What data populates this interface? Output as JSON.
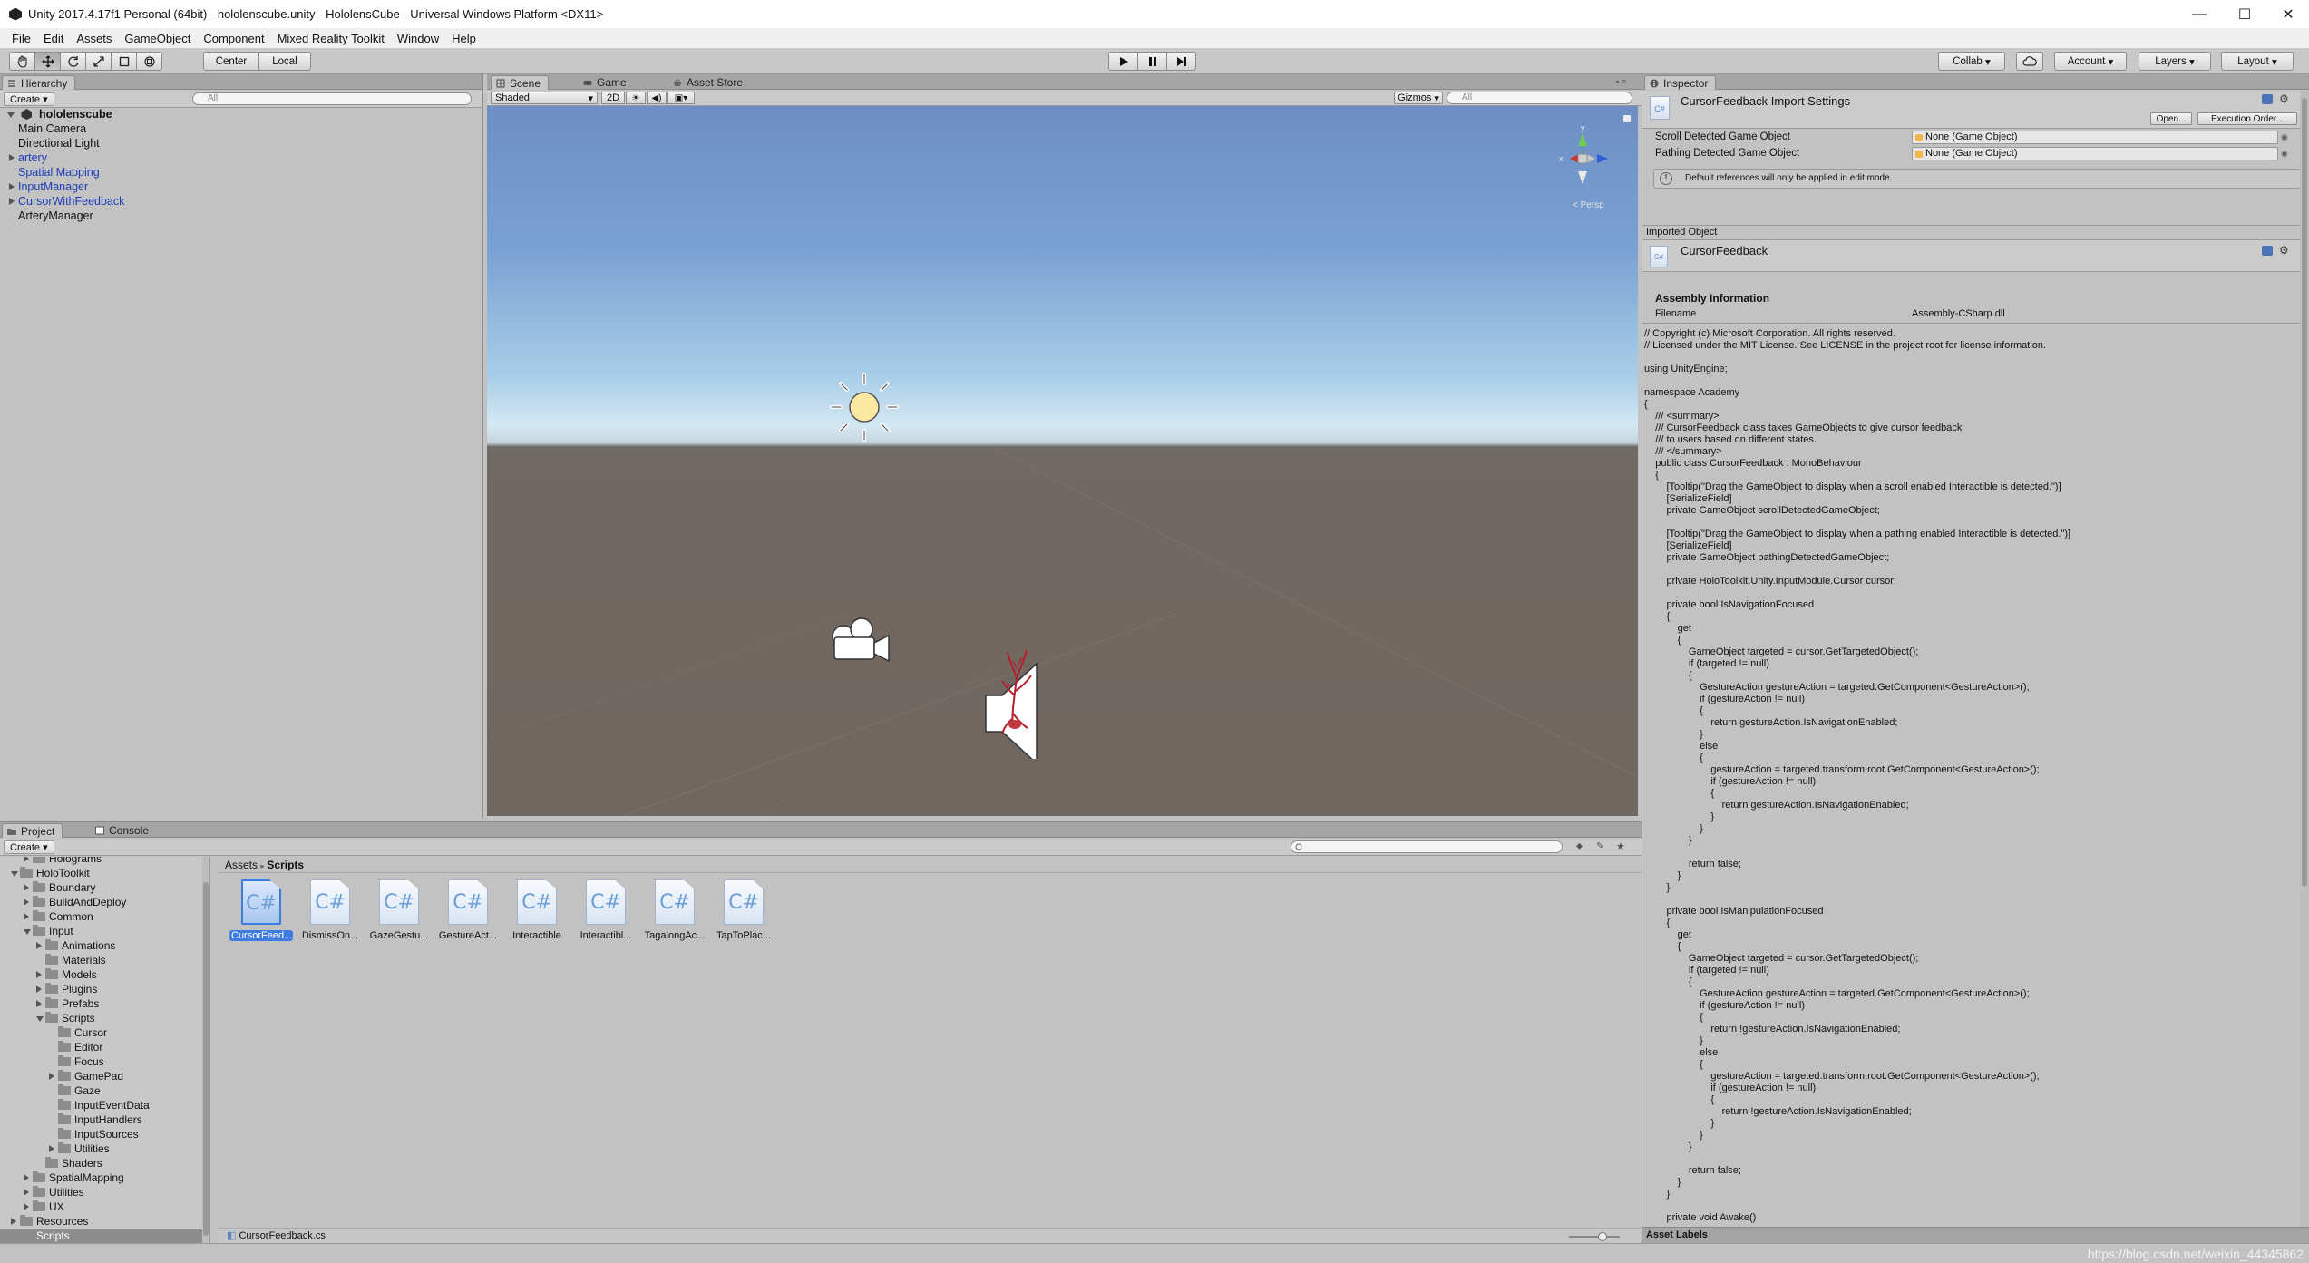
{
  "window": {
    "title": "Unity 2017.4.17f1 Personal (64bit) - hololenscube.unity - HololensCube - Universal Windows Platform <DX11>",
    "minimize": "—",
    "maximize": "☐",
    "close": "✕"
  },
  "menu": [
    "File",
    "Edit",
    "Assets",
    "GameObject",
    "Component",
    "Mixed Reality Toolkit",
    "Window",
    "Help"
  ],
  "toolbar": {
    "pivot": "Center",
    "space": "Local",
    "collab": "Collab",
    "account": "Account",
    "layers": "Layers",
    "layout": "Layout"
  },
  "hierarchy": {
    "tab": "Hierarchy",
    "create": "Create",
    "search_placeholder": "All",
    "scene": "hololenscube",
    "items": [
      {
        "label": "Main Camera",
        "blue": false,
        "expandable": false
      },
      {
        "label": "Directional Light",
        "blue": false,
        "expandable": false
      },
      {
        "label": "artery",
        "blue": true,
        "expandable": true
      },
      {
        "label": "Spatial Mapping",
        "blue": true,
        "expandable": false
      },
      {
        "label": "InputManager",
        "blue": true,
        "expandable": true
      },
      {
        "label": "CursorWithFeedback",
        "blue": true,
        "expandable": true
      },
      {
        "label": "ArteryManager",
        "blue": false,
        "expandable": false
      }
    ]
  },
  "scene": {
    "tabs": [
      "Scene",
      "Game",
      "Asset Store"
    ],
    "shading": "Shaded",
    "mode2d": "2D",
    "gizmos": "Gizmos",
    "search_placeholder": "All",
    "persp": "Persp",
    "axes": {
      "x": "x",
      "y": "y"
    }
  },
  "project": {
    "tabs": [
      "Project",
      "Console"
    ],
    "create": "Create",
    "breadcrumb": [
      "Assets",
      "Scripts"
    ],
    "tree": [
      {
        "label": "Holograms",
        "indent": 2,
        "arrow": "right"
      },
      {
        "label": "HoloToolkit",
        "indent": 1,
        "arrow": "down"
      },
      {
        "label": "Boundary",
        "indent": 2,
        "arrow": "right"
      },
      {
        "label": "BuildAndDeploy",
        "indent": 2,
        "arrow": "right"
      },
      {
        "label": "Common",
        "indent": 2,
        "arrow": "right"
      },
      {
        "label": "Input",
        "indent": 2,
        "arrow": "down"
      },
      {
        "label": "Animations",
        "indent": 3,
        "arrow": "right"
      },
      {
        "label": "Materials",
        "indent": 3,
        "arrow": ""
      },
      {
        "label": "Models",
        "indent": 3,
        "arrow": "right"
      },
      {
        "label": "Plugins",
        "indent": 3,
        "arrow": "right"
      },
      {
        "label": "Prefabs",
        "indent": 3,
        "arrow": "right"
      },
      {
        "label": "Scripts",
        "indent": 3,
        "arrow": "down"
      },
      {
        "label": "Cursor",
        "indent": 4,
        "arrow": ""
      },
      {
        "label": "Editor",
        "indent": 4,
        "arrow": ""
      },
      {
        "label": "Focus",
        "indent": 4,
        "arrow": ""
      },
      {
        "label": "GamePad",
        "indent": 4,
        "arrow": "right"
      },
      {
        "label": "Gaze",
        "indent": 4,
        "arrow": ""
      },
      {
        "label": "InputEventData",
        "indent": 4,
        "arrow": ""
      },
      {
        "label": "InputHandlers",
        "indent": 4,
        "arrow": ""
      },
      {
        "label": "InputSources",
        "indent": 4,
        "arrow": ""
      },
      {
        "label": "Utilities",
        "indent": 4,
        "arrow": "right"
      },
      {
        "label": "Shaders",
        "indent": 3,
        "arrow": ""
      },
      {
        "label": "SpatialMapping",
        "indent": 2,
        "arrow": "right"
      },
      {
        "label": "Utilities",
        "indent": 2,
        "arrow": "right"
      },
      {
        "label": "UX",
        "indent": 2,
        "arrow": "right"
      },
      {
        "label": "Resources",
        "indent": 1,
        "arrow": "right"
      },
      {
        "label": "Scripts",
        "indent": 1,
        "arrow": "",
        "selected": true
      }
    ],
    "assets": [
      "CursorFeed...",
      "DismissOn...",
      "GazeGestu...",
      "GestureAct...",
      "Interactible",
      "Interactibl...",
      "TagalongAc...",
      "TapToPlac..."
    ],
    "asset_glyph": "C#",
    "footer_file": "CursorFeedback.cs"
  },
  "inspector": {
    "tab": "Inspector",
    "title": "CursorFeedback Import Settings",
    "open": "Open...",
    "exec_order": "Execution Order...",
    "fields": [
      {
        "label": "Scroll Detected Game Object",
        "value": "None (Game Object)"
      },
      {
        "label": "Pathing Detected Game Object",
        "value": "None (Game Object)"
      }
    ],
    "info": "Default references will only be applied in edit mode.",
    "imported_object": "Imported Object",
    "object_name": "CursorFeedback",
    "assembly_header": "Assembly Information",
    "filename_label": "Filename",
    "filename_value": "Assembly-CSharp.dll",
    "code": [
      "// Copyright (c) Microsoft Corporation. All rights reserved.",
      "// Licensed under the MIT License. See LICENSE in the project root for license information.",
      "",
      "using UnityEngine;",
      "",
      "namespace Academy",
      "{",
      "    /// <summary>",
      "    /// CursorFeedback class takes GameObjects to give cursor feedback",
      "    /// to users based on different states.",
      "    /// </summary>",
      "    public class CursorFeedback : MonoBehaviour",
      "    {",
      "        [Tooltip(\"Drag the GameObject to display when a scroll enabled Interactible is detected.\")]",
      "        [SerializeField]",
      "        private GameObject scrollDetectedGameObject;",
      "",
      "        [Tooltip(\"Drag the GameObject to display when a pathing enabled Interactible is detected.\")]",
      "        [SerializeField]",
      "        private GameObject pathingDetectedGameObject;",
      "",
      "        private HoloToolkit.Unity.InputModule.Cursor cursor;",
      "",
      "        private bool IsNavigationFocused",
      "        {",
      "            get",
      "            {",
      "                GameObject targeted = cursor.GetTargetedObject();",
      "                if (targeted != null)",
      "                {",
      "                    GestureAction gestureAction = targeted.GetComponent<GestureAction>();",
      "                    if (gestureAction != null)",
      "                    {",
      "                        return gestureAction.IsNavigationEnabled;",
      "                    }",
      "                    else",
      "                    {",
      "                        gestureAction = targeted.transform.root.GetComponent<GestureAction>();",
      "                        if (gestureAction != null)",
      "                        {",
      "                            return gestureAction.IsNavigationEnabled;",
      "                        }",
      "                    }",
      "                }",
      "",
      "                return false;",
      "            }",
      "        }",
      "",
      "        private bool IsManipulationFocused",
      "        {",
      "            get",
      "            {",
      "                GameObject targeted = cursor.GetTargetedObject();",
      "                if (targeted != null)",
      "                {",
      "                    GestureAction gestureAction = targeted.GetComponent<GestureAction>();",
      "                    if (gestureAction != null)",
      "                    {",
      "                        return !gestureAction.IsNavigationEnabled;",
      "                    }",
      "                    else",
      "                    {",
      "                        gestureAction = targeted.transform.root.GetComponent<GestureAction>();",
      "                        if (gestureAction != null)",
      "                        {",
      "                            return !gestureAction.IsNavigationEnabled;",
      "                        }",
      "                    }",
      "                }",
      "",
      "                return false;",
      "            }",
      "        }",
      "",
      "        private void Awake()"
    ],
    "asset_labels": "Asset Labels"
  },
  "watermark": "https://blog.csdn.net/weixin_44345862",
  "colors": {
    "accent": "#3e7de0",
    "link_blue": "#1d3db5"
  }
}
